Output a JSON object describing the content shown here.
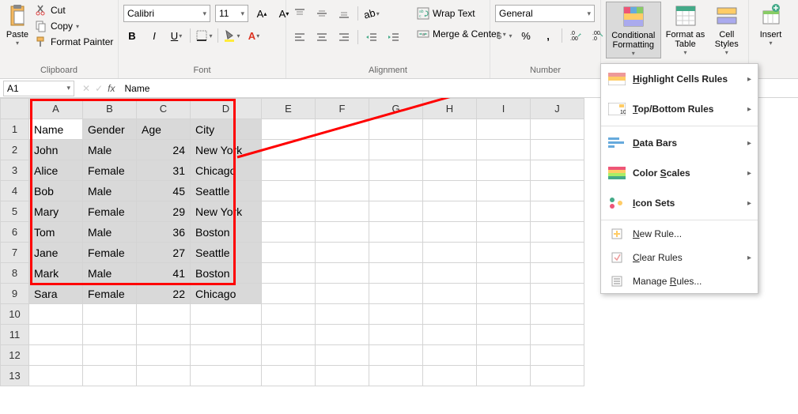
{
  "namebox": "A1",
  "formula_value": "Name",
  "clipboard": {
    "paste": "Paste",
    "cut": "Cut",
    "copy": "Copy",
    "format_painter": "Format Painter",
    "label": "Clipboard"
  },
  "font": {
    "name": "Calibri",
    "size": "11",
    "label": "Font"
  },
  "alignment": {
    "wrap": "Wrap Text",
    "merge": "Merge & Center",
    "label": "Alignment"
  },
  "number": {
    "format": "General",
    "label": "Number"
  },
  "styles": {
    "cond_fmt": "Conditional Formatting",
    "fmt_table": "Format as Table",
    "cell_styles": "Cell Styles"
  },
  "cells": {
    "insert": "Insert"
  },
  "cf_menu": {
    "highlight": "Highlight Cells Rules",
    "topbottom": "Top/Bottom Rules",
    "databars": "Data Bars",
    "colorscales": "Color Scales",
    "iconsets": "Icon Sets",
    "newrule": "New Rule...",
    "clear": "Clear Rules",
    "manage": "Manage Rules..."
  },
  "columns": [
    "A",
    "B",
    "C",
    "D",
    "E",
    "F",
    "G",
    "H",
    "I",
    "J"
  ],
  "rows": [
    "1",
    "2",
    "3",
    "4",
    "5",
    "6",
    "7",
    "8",
    "9",
    "10",
    "11",
    "12",
    "13"
  ],
  "table": {
    "headers": [
      "Name",
      "Gender",
      "Age",
      "City"
    ],
    "data": [
      [
        "John",
        "Male",
        "24",
        "New York"
      ],
      [
        "Alice",
        "Female",
        "31",
        "Chicago"
      ],
      [
        "Bob",
        "Male",
        "45",
        "Seattle"
      ],
      [
        "Mary",
        "Female",
        "29",
        "New York"
      ],
      [
        "Tom",
        "Male",
        "36",
        "Boston"
      ],
      [
        "Jane",
        "Female",
        "27",
        "Seattle"
      ],
      [
        "Mark",
        "Male",
        "41",
        "Boston"
      ],
      [
        "Sara",
        "Female",
        "22",
        "Chicago"
      ]
    ]
  }
}
